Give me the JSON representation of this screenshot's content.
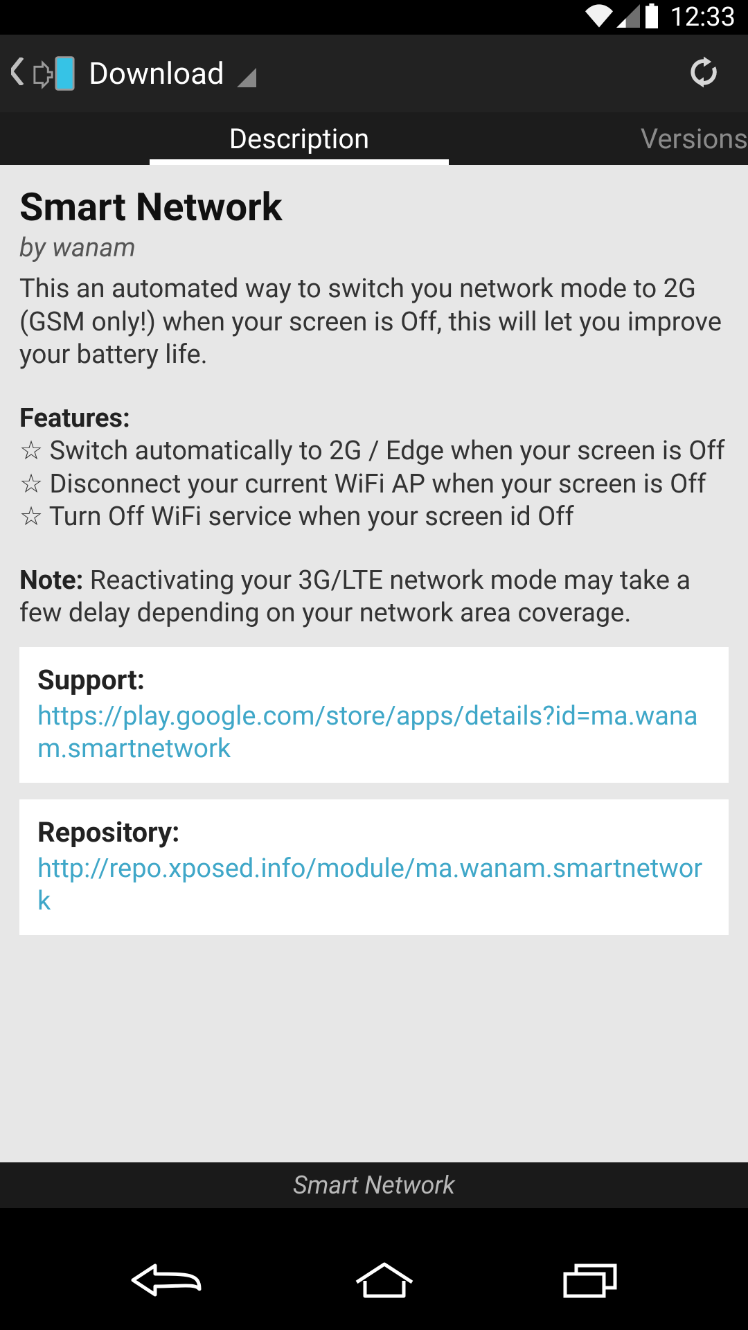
{
  "status": {
    "time": "12:33"
  },
  "actionbar": {
    "title": "Download"
  },
  "tabs": {
    "description": "Description",
    "versions": "Versions"
  },
  "module": {
    "title": "Smart Network",
    "author": "by wanam",
    "intro": "This an automated way to switch you network mode to 2G (GSM only!) when your screen is Off, this will let you improve your battery life.",
    "features_heading": "Features:",
    "features": [
      "☆ Switch automatically to 2G / Edge when your screen is Off",
      "☆ Disconnect your current WiFi AP when your screen is Off",
      "☆ Turn Off WiFi service when your screen id Off"
    ],
    "note_heading": "Note:",
    "note_body": " Reactivating your 3G/LTE network mode may take a few delay depending on your network area coverage."
  },
  "cards": {
    "support_heading": "Support:",
    "support_link": "https://play.google.com/store/apps/details?id=ma.wanam.smartnetwork",
    "repository_heading": "Repository:",
    "repository_link": "http://repo.xposed.info/module/ma.wanam.smartnetwork"
  },
  "footer": {
    "label": "Smart Network"
  }
}
